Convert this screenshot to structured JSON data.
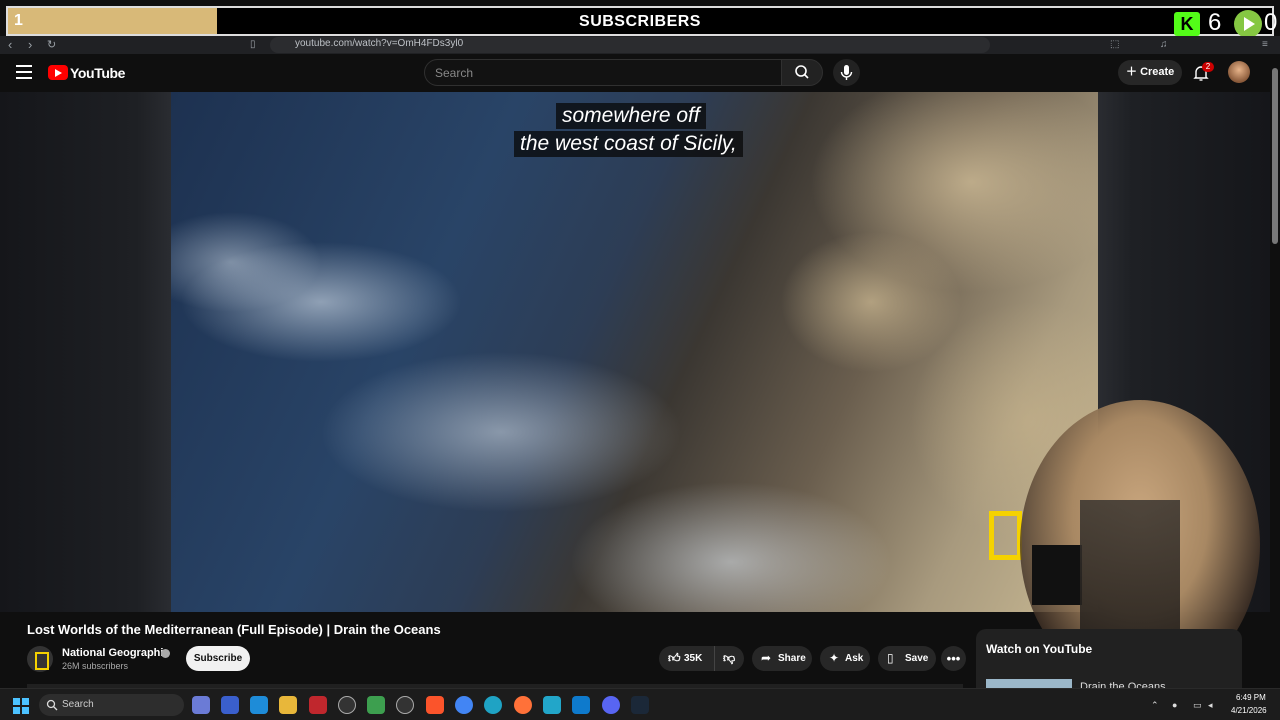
{
  "overlay": {
    "left_count": "1",
    "title": "SUBSCRIBERS",
    "progress_fraction": 0.165,
    "kick_count": "6",
    "rumble_count": "0"
  },
  "browser": {
    "url": "youtube.com/watch?v=OmH4FDs3yl0"
  },
  "header": {
    "logo_text": "YouTube",
    "search_placeholder": "Search",
    "create_label": "Create",
    "notification_count": "2"
  },
  "video": {
    "caption_lines": [
      "somewhere off",
      "the west coast of Sicily,"
    ],
    "title": "Lost Worlds of the Mediterranean (Full Episode) | Drain the Oceans",
    "channel_name": "National Geographic",
    "channel_subscribers": "26M subscribers",
    "subscribe_label": "Subscribe",
    "like_count": "35K",
    "share_label": "Share",
    "ask_label": "Ask",
    "save_label": "Save"
  },
  "sidebar": {
    "watch_on_label": "Watch on YouTube",
    "first_item_title": "Drain the Oceans"
  },
  "taskbar": {
    "search_placeholder": "Search",
    "time": "6:49 PM",
    "date": "4/21/2026"
  },
  "colors": {
    "youtube_red": "#ff0000",
    "kick_green": "#53fc18",
    "rumble_green": "#85c742",
    "overlay_progress": "#d8b978",
    "natgeo_yellow": "#f5d200"
  }
}
